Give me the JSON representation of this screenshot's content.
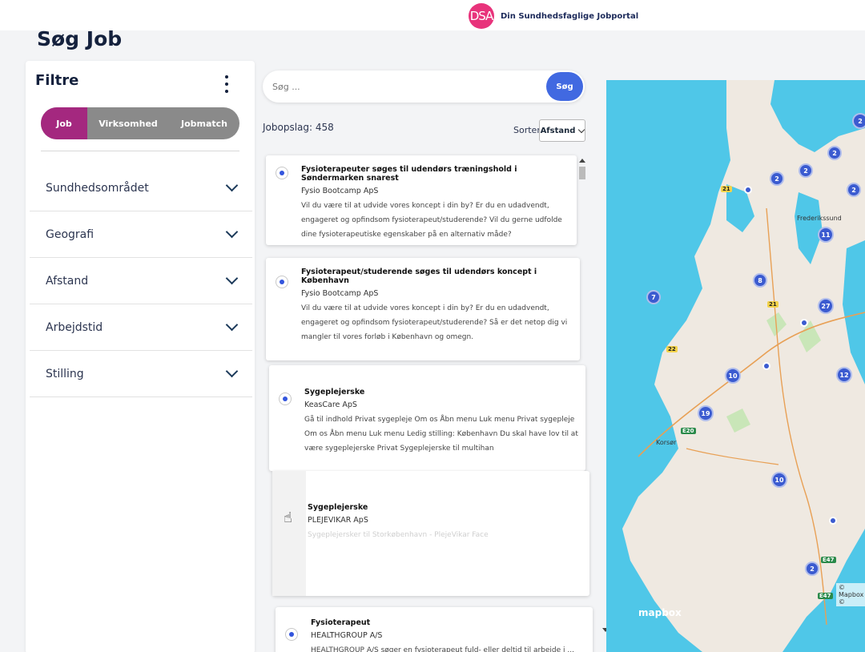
{
  "header": {
    "logo_text": "DSA",
    "tagline": "Din Sundhedsfaglige Jobportal"
  },
  "page_title": "Søg Job",
  "filters": {
    "title": "Filtre",
    "tabs": [
      {
        "label": "Job",
        "active": true
      },
      {
        "label": "Virksomhed",
        "active": false
      },
      {
        "label": "Jobmatch",
        "active": false
      }
    ],
    "facets": [
      {
        "label": "Sundhedsområdet"
      },
      {
        "label": "Geografi"
      },
      {
        "label": "Afstand"
      },
      {
        "label": "Arbejdstid"
      },
      {
        "label": "Stilling"
      }
    ]
  },
  "search": {
    "placeholder": "Søg ...",
    "button_label": "Søg"
  },
  "results": {
    "count_label": "Jobopslag: 458",
    "sort_label": "Sorter:",
    "sort_value": "Afstand",
    "jobs": [
      {
        "title": "Fysioterapeuter søges til udendørs træningshold i Søndermarken snarest",
        "company": "Fysio Bootcamp ApS",
        "description": "Vil du være til at udvide vores koncept i din by? Er du en udadvendt, engageret og opfindsom fysioterapeut/studerende? Vil du gerne udfolde dine fysioterapeutiske egenskaber på en alternativ måde?"
      },
      {
        "title": "Fysioterapeut/studerende søges til udendørs koncept i København",
        "company": "Fysio Bootcamp ApS",
        "description": "Vil du være til at udvide vores koncept i din by? Er du en udadvendt, engageret og opfindsom fysioterapeut/studerende? Så er det netop dig vi mangler til vores forløb i København og omegn."
      },
      {
        "title": "Sygeplejerske",
        "company": "KeasCare ApS",
        "description": "Gå til indhold Privat sygepleje Om os Åbn menu Luk menu Privat sygepleje Om os Åbn menu Luk menu Ledig stilling: København Du skal have lov til at være sygeplejerske Privat Sygeplejerske til multihan"
      },
      {
        "title": "Sygeplejerske",
        "company": "PLEJEVIKAR ApS",
        "description": "Sygeplejersker til Storkøbenhavn - PlejeVikar Face"
      },
      {
        "title": "Fysioterapeut",
        "company": "HEALTHGROUP A/S",
        "description": "HEALTHGROUP A/S søger en fysioterapeut fuld- eller deltid til arbejde i ... Som fysioterapeutisk konsulent"
      }
    ]
  },
  "map": {
    "places": [
      "Frederikssund",
      "Korsør"
    ],
    "roads": [
      "21",
      "21",
      "22",
      "E20",
      "E47",
      "E47"
    ],
    "clusters": [
      "2",
      "2",
      "2",
      "2",
      "2",
      "11",
      "8",
      "7",
      "27",
      "10",
      "12",
      "19",
      "10",
      "2"
    ],
    "attribution": "© Mapbox ©",
    "logo": "mapbox"
  }
}
